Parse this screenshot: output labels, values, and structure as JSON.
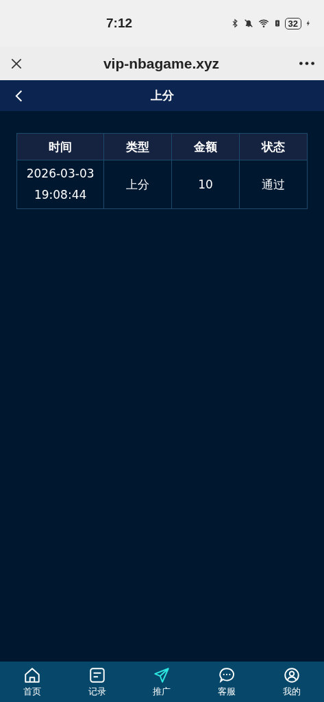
{
  "status_bar": {
    "time": "7:12",
    "battery": "32"
  },
  "browser": {
    "title": "vip-nbagame.xyz"
  },
  "header": {
    "title": "上分"
  },
  "table": {
    "columns": [
      "时间",
      "类型",
      "金额",
      "状态"
    ],
    "rows": [
      {
        "cells": [
          "2026-03-03 19:08:44",
          "上分",
          "10",
          "通过"
        ]
      }
    ]
  },
  "tabs": [
    {
      "label": "首页",
      "kind": "home",
      "selected": false
    },
    {
      "label": "记录",
      "kind": "list",
      "selected": false
    },
    {
      "label": "推广",
      "kind": "send",
      "selected": true
    },
    {
      "label": "客服",
      "kind": "chat",
      "selected": false
    },
    {
      "label": "我的",
      "kind": "user",
      "selected": false
    }
  ]
}
